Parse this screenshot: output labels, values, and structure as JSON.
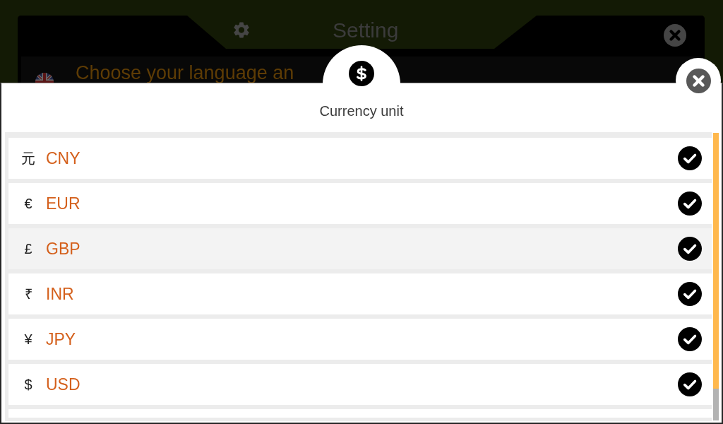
{
  "settings_dialog": {
    "title": "Setting",
    "prompt": "Choose your language an"
  },
  "currency_dialog": {
    "title": "Currency unit",
    "currencies": [
      {
        "symbol": "元",
        "code": "CNY",
        "selected": false,
        "checked": true
      },
      {
        "symbol": "€",
        "code": "EUR",
        "selected": false,
        "checked": true
      },
      {
        "symbol": "£",
        "code": "GBP",
        "selected": true,
        "checked": true
      },
      {
        "symbol": "₹",
        "code": "INR",
        "selected": false,
        "checked": true
      },
      {
        "symbol": "¥",
        "code": "JPY",
        "selected": false,
        "checked": true
      },
      {
        "symbol": "$",
        "code": "USD",
        "selected": false,
        "checked": true
      }
    ]
  }
}
